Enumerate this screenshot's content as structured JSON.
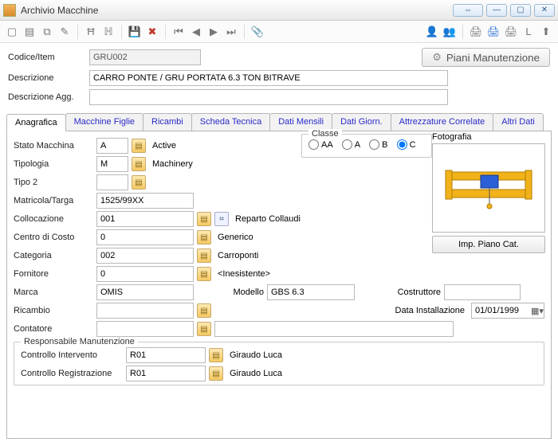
{
  "window": {
    "title": "Archivio Macchine"
  },
  "header": {
    "codice_lbl": "Codice/Item",
    "codice": "GRU002",
    "descr_lbl": "Descrizione",
    "descr": "CARRO PONTE / GRU PORTATA 6.3 TON BITRAVE",
    "descr2_lbl": "Descrizione Agg.",
    "descr2": "",
    "piani_btn": "Piani Manutenzione"
  },
  "tabs": [
    "Anagrafica",
    "Macchine Figlie",
    "Ricambi",
    "Scheda Tecnica",
    "Dati Mensili",
    "Dati Giorn.",
    "Attrezzature Correlate",
    "Altri Dati"
  ],
  "anag": {
    "stato_lbl": "Stato Macchina",
    "stato": "A",
    "stato_desc": "Active",
    "tipologia_lbl": "Tipologia",
    "tipologia": "M",
    "tipologia_desc": "Machinery",
    "tipo2_lbl": "Tipo 2",
    "tipo2": "",
    "matricola_lbl": "Matricola/Targa",
    "matricola": "1525/99XX",
    "colloc_lbl": "Collocazione",
    "colloc": "001",
    "colloc_desc": "Reparto Collaudi",
    "centro_lbl": "Centro di Costo",
    "centro": "0",
    "centro_desc": "Generico",
    "categoria_lbl": "Categoria",
    "categoria": "002",
    "categoria_desc": "Carroponti",
    "fornitore_lbl": "Fornitore",
    "fornitore": "0",
    "fornitore_desc": "<Inesistente>",
    "marca_lbl": "Marca",
    "marca": "OMIS",
    "modello_lbl": "Modello",
    "modello": "GBS 6.3",
    "costruttore_lbl": "Costruttore",
    "costruttore": "",
    "ricambio_lbl": "Ricambio",
    "ricambio": "",
    "datainst_lbl": "Data Installazione",
    "datainst": "01/01/1999",
    "contatore_lbl": "Contatore",
    "contatore": "",
    "contatore2": ""
  },
  "classe": {
    "legend": "Classe",
    "opts": [
      "AA",
      "A",
      "B",
      "C"
    ],
    "value": "C"
  },
  "foto": {
    "legend": "Fotografia",
    "btn": "Imp. Piano Cat."
  },
  "resp": {
    "legend": "Responsabile Manutenzione",
    "ci_lbl": "Controllo Intervento",
    "ci": "R01",
    "ci_desc": "Giraudo Luca",
    "cr_lbl": "Controllo Registrazione",
    "cr": "R01",
    "cr_desc": "Giraudo Luca"
  }
}
